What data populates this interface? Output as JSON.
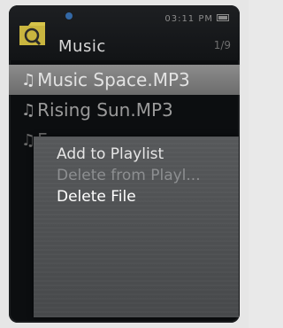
{
  "header": {
    "title": "Music",
    "clock": "03:11 PM",
    "page_count": "1/9",
    "folder_icon": "folder-music-icon",
    "battery_icon": "battery-icon"
  },
  "file_list": [
    {
      "icon": "music-note-icon",
      "label": "Music Space.MP3",
      "state": "selected"
    },
    {
      "icon": "music-note-icon",
      "label": "Rising Sun.MP3",
      "state": "normal"
    },
    {
      "icon": "music-note-icon",
      "label": "F",
      "state": "obscured"
    }
  ],
  "context_menu": {
    "items": [
      {
        "label": "Add to Playlist",
        "state": "enabled"
      },
      {
        "label": "Delete from Playl...",
        "state": "disabled"
      },
      {
        "label": "Delete File",
        "state": "active"
      }
    ]
  },
  "colors": {
    "screen_bg": "#0c0e10",
    "selection": "#7c7c7c",
    "folder": "#d7c44a",
    "accent_dot": "#3a7cc8"
  }
}
